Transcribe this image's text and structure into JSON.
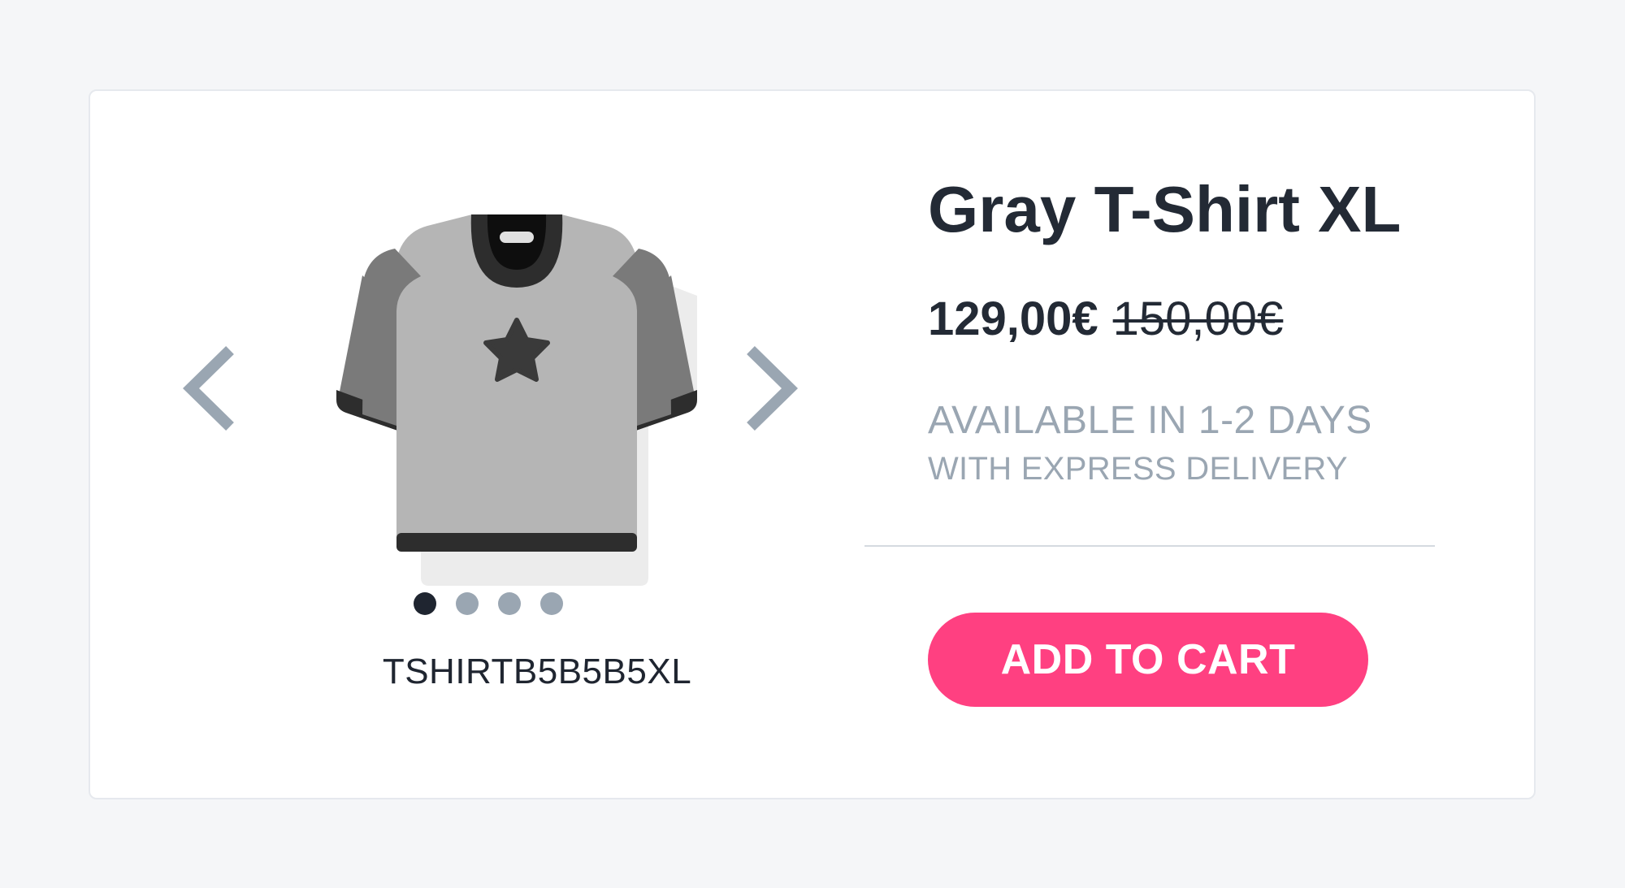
{
  "product": {
    "title": "Gray T-Shirt XL",
    "price_current": "129,00€",
    "price_old": "150,00€",
    "availability_line1": "AVAILABLE IN 1-2 DAYS",
    "availability_line2": "WITH EXPRESS DELIVERY",
    "sku": "TSHIRTB5B5B5XL",
    "add_to_cart_label": "ADD TO CART"
  },
  "gallery": {
    "image_count": 4,
    "active_index": 0,
    "prev_icon": "chevron-left-icon",
    "next_icon": "chevron-right-icon",
    "image_icon": "t-shirt-star-icon"
  },
  "colors": {
    "accent": "#ff4081",
    "muted": "#9aa6b2",
    "text": "#232a35",
    "shirt_body": "#b5b5b5",
    "shirt_sleeve": "#7a7a7a"
  }
}
